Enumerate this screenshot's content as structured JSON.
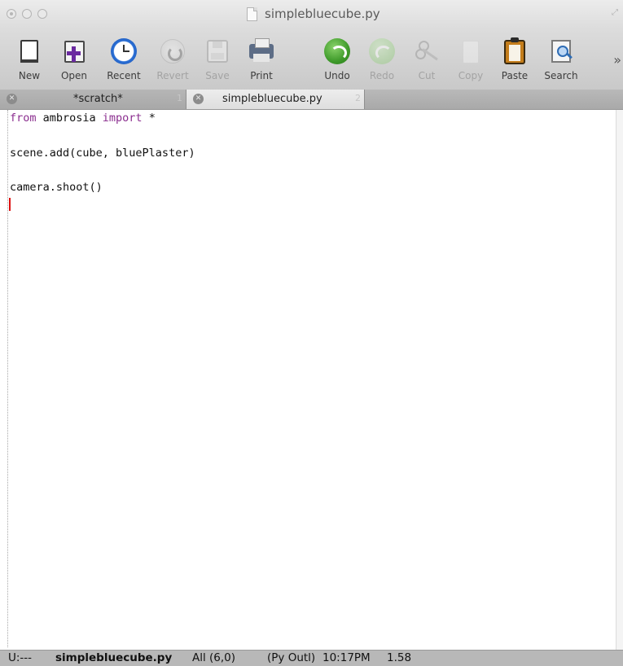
{
  "window": {
    "title": "simplebluecube.py"
  },
  "toolbar": {
    "items": [
      {
        "label": "New",
        "icon": "new-document-icon",
        "enabled": true
      },
      {
        "label": "Open",
        "icon": "open-document-icon",
        "enabled": true
      },
      {
        "label": "Recent",
        "icon": "clock-icon",
        "enabled": true
      },
      {
        "label": "Revert",
        "icon": "revert-icon",
        "enabled": false
      },
      {
        "label": "Save",
        "icon": "save-icon",
        "enabled": false
      },
      {
        "label": "Print",
        "icon": "printer-icon",
        "enabled": true
      },
      {
        "label": "Undo",
        "icon": "undo-icon",
        "enabled": true
      },
      {
        "label": "Redo",
        "icon": "redo-icon",
        "enabled": false
      },
      {
        "label": "Cut",
        "icon": "scissors-icon",
        "enabled": false
      },
      {
        "label": "Copy",
        "icon": "copy-icon",
        "enabled": false
      },
      {
        "label": "Paste",
        "icon": "clipboard-icon",
        "enabled": true
      },
      {
        "label": "Search",
        "icon": "magnifier-icon",
        "enabled": true
      }
    ],
    "overflow": "»"
  },
  "tabs": [
    {
      "label": "*scratch*",
      "number": "1",
      "active": false
    },
    {
      "label": "simplebluecube.py",
      "number": "2",
      "active": true
    }
  ],
  "editor": {
    "lines": [
      {
        "parts": [
          {
            "text": "from",
            "kw": true
          },
          {
            "text": " ambrosia ",
            "kw": false
          },
          {
            "text": "import",
            "kw": true
          },
          {
            "text": " *",
            "kw": false
          }
        ]
      },
      {
        "parts": []
      },
      {
        "parts": [
          {
            "text": "scene.add(cube, bluePlaster)",
            "kw": false
          }
        ]
      },
      {
        "parts": []
      },
      {
        "parts": [
          {
            "text": "camera.shoot()",
            "kw": false
          }
        ]
      }
    ],
    "keyword_color": "#8b2e8f",
    "cursor_color": "#dd1111"
  },
  "modeline": {
    "state": "U:---",
    "buffer": "simplebluecube.py",
    "position": "All (6,0)",
    "modes": "(Py Outl)",
    "time": "10:17PM",
    "load": "1.58"
  }
}
